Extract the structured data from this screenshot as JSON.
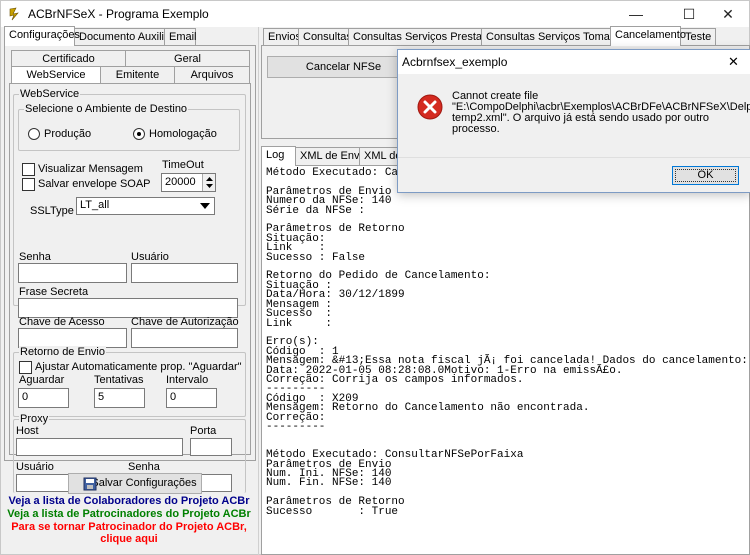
{
  "window": {
    "title": "ACBrNFSeX - Programa Exemplo",
    "minimize": "—",
    "maximize": "☐",
    "close": "✕"
  },
  "left_tabs": [
    "Configurações",
    "Documento Auxiliar",
    "Email"
  ],
  "config_tabs_row1": [
    "Certificado",
    "Geral"
  ],
  "config_tabs_row2": [
    "WebService",
    "Emitente",
    "Arquivos"
  ],
  "webservice": {
    "group_label": "WebService",
    "ambiente": {
      "group_label": "Selecione o Ambiente de Destino",
      "options": [
        "Produção",
        "Homologação"
      ],
      "selected": "Homologação"
    },
    "visualizar_mensagem": "Visualizar Mensagem",
    "salvar_envelope": "Salvar envelope SOAP",
    "timeout_label": "TimeOut",
    "timeout_value": "20000",
    "ssltype_label": "SSLType",
    "ssltype_value": "LT_all",
    "senha_label": "Senha",
    "usuario_label": "Usuário",
    "frase_secreta_label": "Frase Secreta",
    "chave_acesso_label": "Chave de Acesso",
    "chave_autorizacao_label": "Chave de Autorização"
  },
  "retorno": {
    "group_label": "Retorno de Envio",
    "ajustar": "Ajustar Automaticamente prop. \"Aguardar\"",
    "aguardar_label": "Aguardar",
    "aguardar_value": "0",
    "tentativas_label": "Tentativas",
    "tentativas_value": "5",
    "intervalo_label": "Intervalo",
    "intervalo_value": "0"
  },
  "proxy": {
    "group_label": "Proxy",
    "host_label": "Host",
    "porta_label": "Porta",
    "usuario_label": "Usuário",
    "senha_label": "Senha"
  },
  "salvar_button": "Salvar Configurações",
  "links": [
    {
      "text": "Veja a lista de Colaboradores do Projeto ACBr",
      "color": "#00008b"
    },
    {
      "text": "Veja a lista de Patrocinadores do Projeto ACBr",
      "color": "#008000"
    },
    {
      "text": "Para se tornar Patrocinador do Projeto ACBr,",
      "color": "#ff0000"
    },
    {
      "text": "clique aqui",
      "color": "#ff0000"
    }
  ],
  "right_tabs": [
    "Envios",
    "Consultas",
    "Consultas Serviços Prestados",
    "Consultas Serviços Tomados",
    "Cancelamento",
    "Teste"
  ],
  "cancelar_button": "Cancelar NFSe",
  "log_tabs": [
    "Log",
    "XML de Envio",
    "XML de"
  ],
  "log_lines": [
    "Método Executado: Canc",
    "",
    "Parâmetros de Envio",
    "Numero da NFSe: 140",
    "Série da NFSe :",
    "",
    "Parâmetros de Retorno",
    "Situação:",
    "Link    :",
    "Sucesso : False",
    "",
    "Retorno do Pedido de Cancelamento:",
    "Situação :",
    "Data/Hora: 30/12/1899",
    "Mensagem :",
    "Sucesso  :",
    "Link     :",
    "",
    "Erro(s):",
    "Código  : 1",
    "Mensagem: &#13;Essa nota fiscal jÃ¡ foi cancelada! Dados do cancelamento:",
    "Data: 2022-01-05 08:28:08.0Motivo: 1-Erro na emissÃ£o.",
    "Correção: Corrija os campos informados.",
    "---------",
    "Código  : X209",
    "Mensagem: Retorno do Cancelamento não encontrada.",
    "Correção:",
    "---------",
    "",
    "",
    "Método Executado: ConsultarNFSePorFaixa",
    "Parâmetros de Envio",
    "Num. Ini. NFSe: 140",
    "Num. Fin. NFSe: 140",
    "",
    "Parâmetros de Retorno",
    "Sucesso       : True"
  ],
  "dialog": {
    "title": "Acbrnfsex_exemplo",
    "close": "✕",
    "message_lines": [
      "Cannot create file",
      "\"E:\\CompoDelphi\\acbr\\Exemplos\\ACBrDFe\\ACBrNFSeX\\Delphi\\",
      "temp2.xml\". O arquivo já está sendo usado por outro",
      "processo."
    ],
    "ok": "OK"
  }
}
